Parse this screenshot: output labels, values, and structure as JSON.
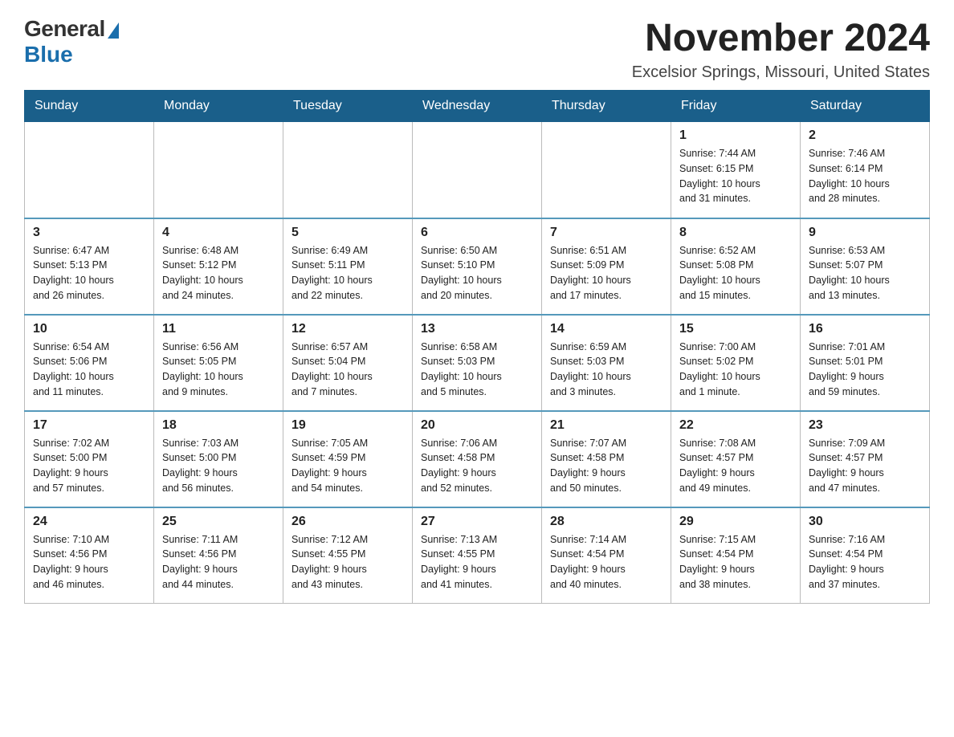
{
  "header": {
    "logo_general": "General",
    "logo_blue": "Blue",
    "month_title": "November 2024",
    "location": "Excelsior Springs, Missouri, United States"
  },
  "days_of_week": [
    "Sunday",
    "Monday",
    "Tuesday",
    "Wednesday",
    "Thursday",
    "Friday",
    "Saturday"
  ],
  "weeks": [
    [
      {
        "day": "",
        "info": ""
      },
      {
        "day": "",
        "info": ""
      },
      {
        "day": "",
        "info": ""
      },
      {
        "day": "",
        "info": ""
      },
      {
        "day": "",
        "info": ""
      },
      {
        "day": "1",
        "info": "Sunrise: 7:44 AM\nSunset: 6:15 PM\nDaylight: 10 hours\nand 31 minutes."
      },
      {
        "day": "2",
        "info": "Sunrise: 7:46 AM\nSunset: 6:14 PM\nDaylight: 10 hours\nand 28 minutes."
      }
    ],
    [
      {
        "day": "3",
        "info": "Sunrise: 6:47 AM\nSunset: 5:13 PM\nDaylight: 10 hours\nand 26 minutes."
      },
      {
        "day": "4",
        "info": "Sunrise: 6:48 AM\nSunset: 5:12 PM\nDaylight: 10 hours\nand 24 minutes."
      },
      {
        "day": "5",
        "info": "Sunrise: 6:49 AM\nSunset: 5:11 PM\nDaylight: 10 hours\nand 22 minutes."
      },
      {
        "day": "6",
        "info": "Sunrise: 6:50 AM\nSunset: 5:10 PM\nDaylight: 10 hours\nand 20 minutes."
      },
      {
        "day": "7",
        "info": "Sunrise: 6:51 AM\nSunset: 5:09 PM\nDaylight: 10 hours\nand 17 minutes."
      },
      {
        "day": "8",
        "info": "Sunrise: 6:52 AM\nSunset: 5:08 PM\nDaylight: 10 hours\nand 15 minutes."
      },
      {
        "day": "9",
        "info": "Sunrise: 6:53 AM\nSunset: 5:07 PM\nDaylight: 10 hours\nand 13 minutes."
      }
    ],
    [
      {
        "day": "10",
        "info": "Sunrise: 6:54 AM\nSunset: 5:06 PM\nDaylight: 10 hours\nand 11 minutes."
      },
      {
        "day": "11",
        "info": "Sunrise: 6:56 AM\nSunset: 5:05 PM\nDaylight: 10 hours\nand 9 minutes."
      },
      {
        "day": "12",
        "info": "Sunrise: 6:57 AM\nSunset: 5:04 PM\nDaylight: 10 hours\nand 7 minutes."
      },
      {
        "day": "13",
        "info": "Sunrise: 6:58 AM\nSunset: 5:03 PM\nDaylight: 10 hours\nand 5 minutes."
      },
      {
        "day": "14",
        "info": "Sunrise: 6:59 AM\nSunset: 5:03 PM\nDaylight: 10 hours\nand 3 minutes."
      },
      {
        "day": "15",
        "info": "Sunrise: 7:00 AM\nSunset: 5:02 PM\nDaylight: 10 hours\nand 1 minute."
      },
      {
        "day": "16",
        "info": "Sunrise: 7:01 AM\nSunset: 5:01 PM\nDaylight: 9 hours\nand 59 minutes."
      }
    ],
    [
      {
        "day": "17",
        "info": "Sunrise: 7:02 AM\nSunset: 5:00 PM\nDaylight: 9 hours\nand 57 minutes."
      },
      {
        "day": "18",
        "info": "Sunrise: 7:03 AM\nSunset: 5:00 PM\nDaylight: 9 hours\nand 56 minutes."
      },
      {
        "day": "19",
        "info": "Sunrise: 7:05 AM\nSunset: 4:59 PM\nDaylight: 9 hours\nand 54 minutes."
      },
      {
        "day": "20",
        "info": "Sunrise: 7:06 AM\nSunset: 4:58 PM\nDaylight: 9 hours\nand 52 minutes."
      },
      {
        "day": "21",
        "info": "Sunrise: 7:07 AM\nSunset: 4:58 PM\nDaylight: 9 hours\nand 50 minutes."
      },
      {
        "day": "22",
        "info": "Sunrise: 7:08 AM\nSunset: 4:57 PM\nDaylight: 9 hours\nand 49 minutes."
      },
      {
        "day": "23",
        "info": "Sunrise: 7:09 AM\nSunset: 4:57 PM\nDaylight: 9 hours\nand 47 minutes."
      }
    ],
    [
      {
        "day": "24",
        "info": "Sunrise: 7:10 AM\nSunset: 4:56 PM\nDaylight: 9 hours\nand 46 minutes."
      },
      {
        "day": "25",
        "info": "Sunrise: 7:11 AM\nSunset: 4:56 PM\nDaylight: 9 hours\nand 44 minutes."
      },
      {
        "day": "26",
        "info": "Sunrise: 7:12 AM\nSunset: 4:55 PM\nDaylight: 9 hours\nand 43 minutes."
      },
      {
        "day": "27",
        "info": "Sunrise: 7:13 AM\nSunset: 4:55 PM\nDaylight: 9 hours\nand 41 minutes."
      },
      {
        "day": "28",
        "info": "Sunrise: 7:14 AM\nSunset: 4:54 PM\nDaylight: 9 hours\nand 40 minutes."
      },
      {
        "day": "29",
        "info": "Sunrise: 7:15 AM\nSunset: 4:54 PM\nDaylight: 9 hours\nand 38 minutes."
      },
      {
        "day": "30",
        "info": "Sunrise: 7:16 AM\nSunset: 4:54 PM\nDaylight: 9 hours\nand 37 minutes."
      }
    ]
  ]
}
